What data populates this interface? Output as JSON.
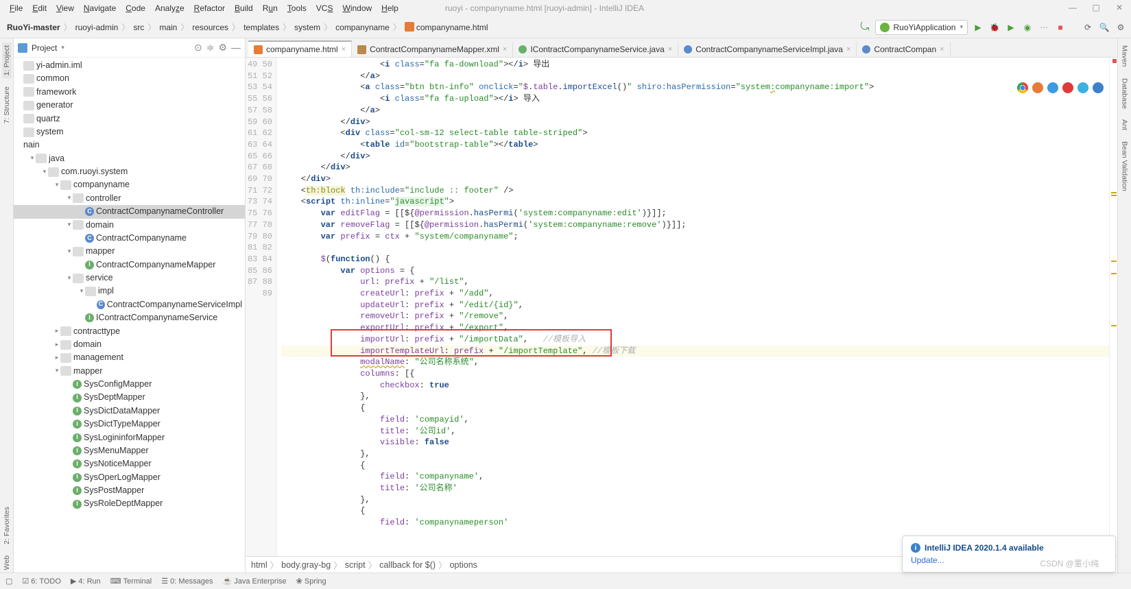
{
  "window": {
    "title": "ruoyi - companyname.html [ruoyi-admin] - IntelliJ IDEA"
  },
  "menu": [
    "File",
    "Edit",
    "View",
    "Navigate",
    "Code",
    "Analyze",
    "Refactor",
    "Build",
    "Run",
    "Tools",
    "VCS",
    "Window",
    "Help"
  ],
  "breadcrumb": [
    "RuoYi-master",
    "ruoyi-admin",
    "src",
    "main",
    "resources",
    "templates",
    "system",
    "companyname",
    "companyname.html"
  ],
  "runConfig": "RuoYiApplication",
  "projectPanel": {
    "title": "Project"
  },
  "tree": [
    {
      "d": 0,
      "t": "",
      "ic": "dir",
      "lbl": "yi-admin.iml"
    },
    {
      "d": 0,
      "t": "",
      "ic": "dir",
      "lbl": "common"
    },
    {
      "d": 0,
      "t": "",
      "ic": "dir",
      "lbl": "framework"
    },
    {
      "d": 0,
      "t": "",
      "ic": "dir",
      "lbl": "generator"
    },
    {
      "d": 0,
      "t": "",
      "ic": "dir",
      "lbl": "quartz"
    },
    {
      "d": 0,
      "t": "",
      "ic": "dir",
      "lbl": "system"
    },
    {
      "d": 0,
      "t": "",
      "ic": "",
      "lbl": "nain"
    },
    {
      "d": 1,
      "t": "down",
      "ic": "dir",
      "lbl": "java"
    },
    {
      "d": 2,
      "t": "down",
      "ic": "pkg",
      "lbl": "com.ruoyi.system"
    },
    {
      "d": 3,
      "t": "down",
      "ic": "pkg",
      "lbl": "companyname"
    },
    {
      "d": 4,
      "t": "down",
      "ic": "pkg",
      "lbl": "controller"
    },
    {
      "d": 5,
      "t": "",
      "ic": "cls",
      "lbl": "ContractCompanynameController",
      "sel": true
    },
    {
      "d": 4,
      "t": "down",
      "ic": "pkg",
      "lbl": "domain"
    },
    {
      "d": 5,
      "t": "",
      "ic": "cls",
      "lbl": "ContractCompanyname"
    },
    {
      "d": 4,
      "t": "down",
      "ic": "pkg",
      "lbl": "mapper"
    },
    {
      "d": 5,
      "t": "",
      "ic": "intf",
      "lbl": "ContractCompanynameMapper"
    },
    {
      "d": 4,
      "t": "down",
      "ic": "pkg",
      "lbl": "service"
    },
    {
      "d": 5,
      "t": "down",
      "ic": "pkg",
      "lbl": "impl"
    },
    {
      "d": 6,
      "t": "",
      "ic": "cls",
      "lbl": "ContractCompanynameServiceImpl"
    },
    {
      "d": 5,
      "t": "",
      "ic": "intf",
      "lbl": "IContractCompanynameService"
    },
    {
      "d": 3,
      "t": "right",
      "ic": "pkg",
      "lbl": "contracttype"
    },
    {
      "d": 3,
      "t": "right",
      "ic": "pkg",
      "lbl": "domain"
    },
    {
      "d": 3,
      "t": "right",
      "ic": "pkg",
      "lbl": "management"
    },
    {
      "d": 3,
      "t": "down",
      "ic": "pkg",
      "lbl": "mapper"
    },
    {
      "d": 4,
      "t": "",
      "ic": "intf",
      "lbl": "SysConfigMapper"
    },
    {
      "d": 4,
      "t": "",
      "ic": "intf",
      "lbl": "SysDeptMapper"
    },
    {
      "d": 4,
      "t": "",
      "ic": "intf",
      "lbl": "SysDictDataMapper"
    },
    {
      "d": 4,
      "t": "",
      "ic": "intf",
      "lbl": "SysDictTypeMapper"
    },
    {
      "d": 4,
      "t": "",
      "ic": "intf",
      "lbl": "SysLogininforMapper"
    },
    {
      "d": 4,
      "t": "",
      "ic": "intf",
      "lbl": "SysMenuMapper"
    },
    {
      "d": 4,
      "t": "",
      "ic": "intf",
      "lbl": "SysNoticeMapper"
    },
    {
      "d": 4,
      "t": "",
      "ic": "intf",
      "lbl": "SysOperLogMapper"
    },
    {
      "d": 4,
      "t": "",
      "ic": "intf",
      "lbl": "SysPostMapper"
    },
    {
      "d": 4,
      "t": "",
      "ic": "intf",
      "lbl": "SysRoleDeptMapper"
    }
  ],
  "tabs": [
    {
      "ic": "html",
      "lbl": "companyname.html",
      "active": true
    },
    {
      "ic": "xml",
      "lbl": "ContractCompanynameMapper.xml"
    },
    {
      "ic": "intf",
      "lbl": "IContractCompanynameService.java"
    },
    {
      "ic": "cls",
      "lbl": "ContractCompanynameServiceImpl.java"
    },
    {
      "ic": "cls",
      "lbl": "ContractCompan"
    }
  ],
  "lineStart": 49,
  "lineEnd": 89,
  "structPath": [
    "html",
    "body.gray-bg",
    "script",
    "callback for $()",
    "options"
  ],
  "leftTabs": [
    "1: Project",
    "7: Structure",
    "2: Favorites",
    "Web"
  ],
  "rightTabs": [
    "Maven",
    "Database",
    "Ant",
    "Bean Validation"
  ],
  "toolwins": [
    "6: TODO",
    "4: Run",
    "Terminal",
    "0: Messages",
    "Java Enterprise",
    "Spring"
  ],
  "notif": {
    "title": "IntelliJ IDEA 2020.1.4 available",
    "link": "Update..."
  },
  "watermark": "CSDN @董小纯",
  "browserColors": [
    "#f2c14e",
    "#e87b36",
    "#3b9ae1",
    "#e03a3a",
    "#3bb1e1",
    "#3b82c9"
  ]
}
